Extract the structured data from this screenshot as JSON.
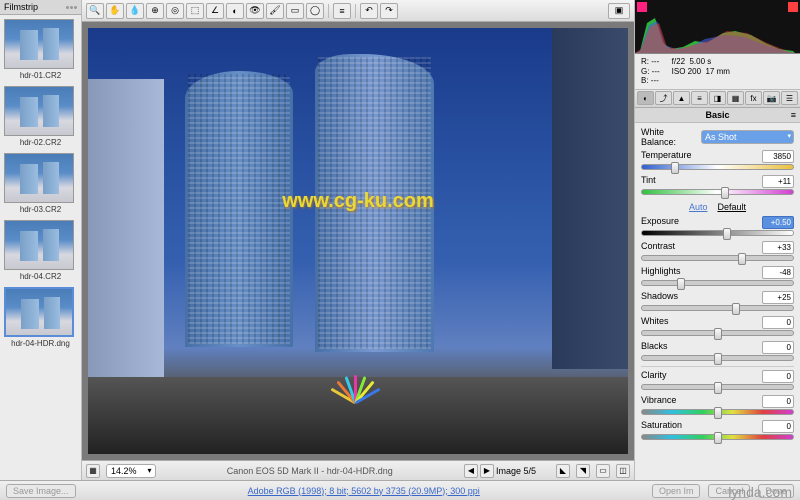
{
  "filmstrip": {
    "title": "Filmstrip",
    "items": [
      {
        "label": "hdr-01.CR2"
      },
      {
        "label": "hdr-02.CR2"
      },
      {
        "label": "hdr-03.CR2"
      },
      {
        "label": "hdr-04.CR2"
      },
      {
        "label": "hdr-04-HDR.dng"
      }
    ],
    "selected_index": 4
  },
  "toolbar": {
    "icons": [
      "zoom",
      "hand",
      "eyedrop",
      "target",
      "crop",
      "straighten",
      "spot",
      "redeye",
      "brush",
      "gradient",
      "radial",
      "sort",
      "pref",
      "rotate-ccw",
      "rotate-cw"
    ]
  },
  "canvas": {
    "watermark": "www.cg-ku.com"
  },
  "status": {
    "zoom": "14.2%",
    "info": "Canon EOS 5D Mark II - hdr-04-HDR.dng",
    "image_index": "Image 5/5"
  },
  "rgb": {
    "r": "---",
    "g": "---",
    "b": "---",
    "aperture": "f/22",
    "shutter": "5.00 s",
    "iso": "ISO 200",
    "focal": "17 mm"
  },
  "panel": {
    "title": "Basic",
    "white_balance_label": "White Balance:",
    "white_balance_value": "As Shot",
    "auto_label": "Auto",
    "default_label": "Default",
    "sliders": {
      "temperature": {
        "label": "Temperature",
        "value": "3850",
        "pos": 22
      },
      "tint": {
        "label": "Tint",
        "value": "+11",
        "pos": 55
      },
      "exposure": {
        "label": "Exposure",
        "value": "+0.50",
        "pos": 56,
        "selected": true
      },
      "contrast": {
        "label": "Contrast",
        "value": "+33",
        "pos": 66
      },
      "highlights": {
        "label": "Highlights",
        "value": "-48",
        "pos": 26
      },
      "shadows": {
        "label": "Shadows",
        "value": "+25",
        "pos": 62
      },
      "whites": {
        "label": "Whites",
        "value": "0",
        "pos": 50
      },
      "blacks": {
        "label": "Blacks",
        "value": "0",
        "pos": 50
      },
      "clarity": {
        "label": "Clarity",
        "value": "0",
        "pos": 50
      },
      "vibrance": {
        "label": "Vibrance",
        "value": "0",
        "pos": 50
      },
      "saturation": {
        "label": "Saturation",
        "value": "0",
        "pos": 50
      }
    }
  },
  "bottom": {
    "save": "Save Image...",
    "link": "Adobe RGB (1998); 8 bit; 5602 by 3735 (20.9MP); 300 ppi",
    "open": "Open Im",
    "cancel": "Cancel",
    "done": "Done"
  },
  "brand": "lynda.com"
}
